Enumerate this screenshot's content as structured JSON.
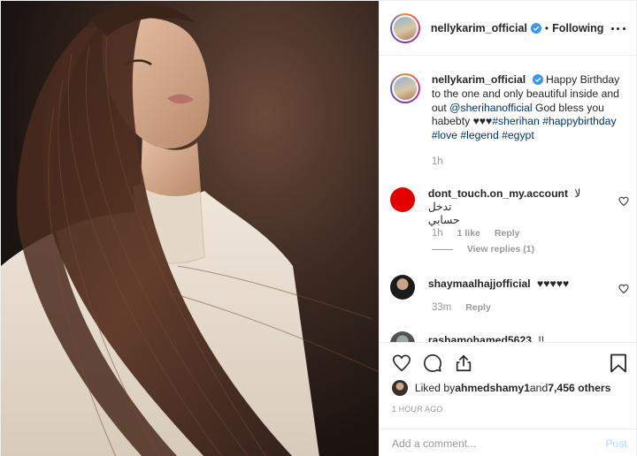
{
  "post": {
    "username": "nellykarim_official",
    "follow_status": "Following",
    "separator": "•"
  },
  "caption": {
    "username": "nellykarim_official",
    "text_part1": " Happy Birthday to the one and only beautiful inside and out ",
    "mention": "@sherihanofficial",
    "text_part2": " God bless you habebty ♥♥♥",
    "hashtags": [
      "#sherihan",
      "#happybirthday",
      "#love",
      "#legend",
      "#egypt"
    ],
    "time": "1h"
  },
  "comments": [
    {
      "username": "dont_touch.on_my.account",
      "text_line1": "لا",
      "text_line2": "تدخل حسابي",
      "time": "1h",
      "likes": "1 like",
      "reply": "Reply",
      "avatar_color": "#e50000"
    },
    {
      "username": "shaymaalhajjofficial",
      "text": "♥♥♥♥♥",
      "time": "33m",
      "reply": "Reply"
    },
    {
      "username": "rashamohamed5623",
      "text": "!!"
    }
  ],
  "view_replies": "View replies (1)",
  "likes": {
    "prefix": "Liked by ",
    "user": "ahmedshamy1",
    "middle": " and ",
    "count": "7,456 others"
  },
  "timestamp": "1 HOUR AGO",
  "add_comment": {
    "placeholder": "Add a comment...",
    "post_label": "Post"
  },
  "colors": {
    "link": "#003569",
    "verified": "#3897f0",
    "muted": "#999999"
  }
}
